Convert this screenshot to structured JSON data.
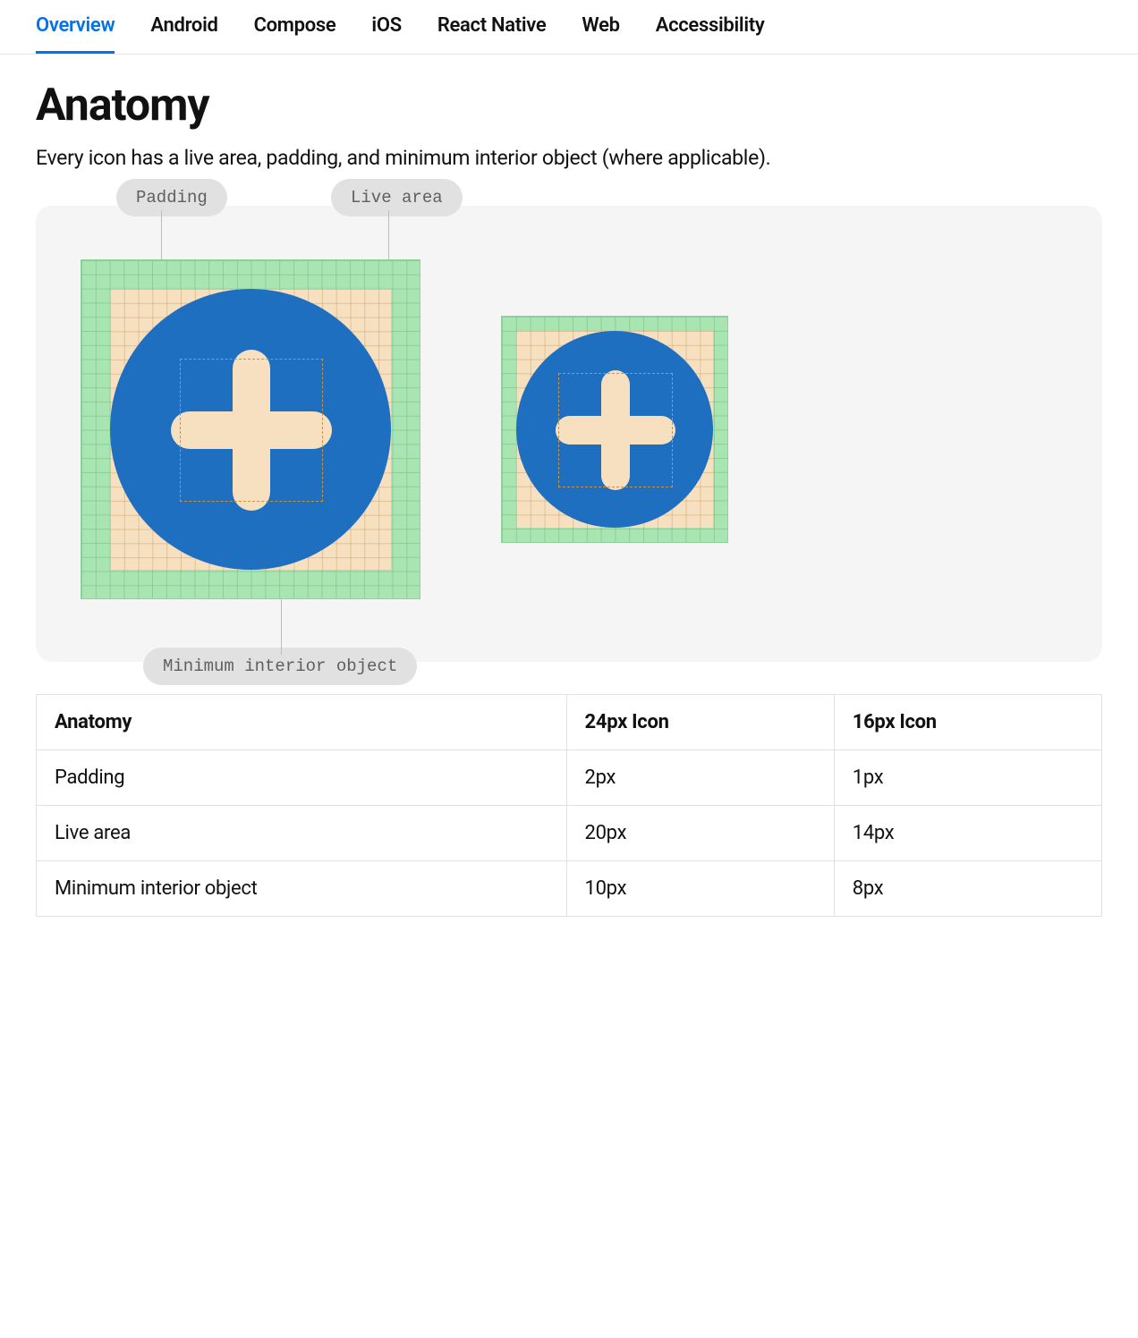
{
  "tabs": [
    {
      "label": "Overview"
    },
    {
      "label": "Android"
    },
    {
      "label": "Compose"
    },
    {
      "label": "iOS"
    },
    {
      "label": "React Native"
    },
    {
      "label": "Web"
    },
    {
      "label": "Accessibility"
    }
  ],
  "heading": "Anatomy",
  "lead": "Every icon has a live area, padding, and minimum interior object (where applicable).",
  "diagram": {
    "label_padding": "Padding",
    "label_live": "Live area",
    "label_min": "Minimum interior object"
  },
  "table": {
    "headers": [
      "Anatomy",
      "24px Icon",
      "16px Icon"
    ],
    "rows": [
      [
        "Padding",
        "2px",
        "1px"
      ],
      [
        "Live area",
        "20px",
        "14px"
      ],
      [
        "Minimum interior object",
        "10px",
        "8px"
      ]
    ]
  }
}
